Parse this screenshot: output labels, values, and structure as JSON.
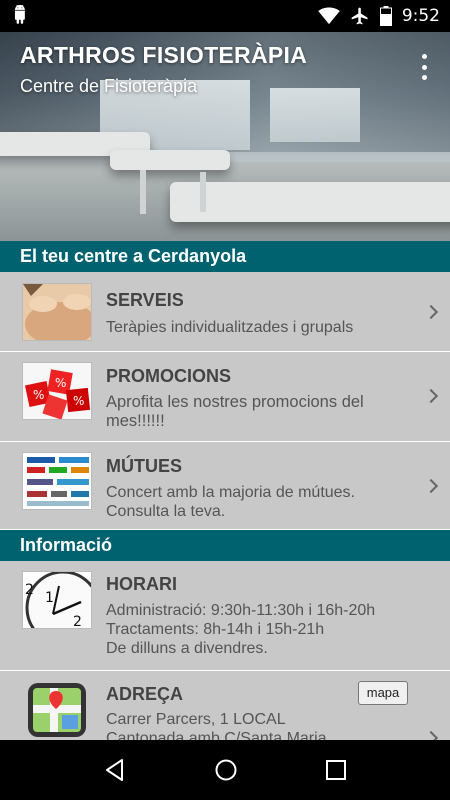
{
  "status_bar": {
    "time": "9:52",
    "battery_level": 0.6
  },
  "header": {
    "title": "ARTHROS FISIOTERÀPIA",
    "subtitle": "Centre de Fisioteràpia"
  },
  "sections": [
    {
      "title": "El teu centre a Cerdanyola",
      "items": [
        {
          "title": "SERVEIS",
          "description": "Teràpies individualitzades i grupals",
          "icon": "massage-photo-icon"
        },
        {
          "title": "PROMOCIONS",
          "description": "Aprofita les nostres promocions del mes!!!!!!",
          "icon": "percent-dice-icon"
        },
        {
          "title": "MÚTUES",
          "description": "Concert amb la majoria de mútues. Consulta la teva.",
          "icon": "insurance-logos-icon"
        }
      ]
    },
    {
      "title": "Informació",
      "items": [
        {
          "title": "HORARI",
          "lines": [
            "Administració: 9:30h-11:30h i 16h-20h",
            "Tractaments: 8h-14h i 15h-21h",
            "De dilluns a divendres."
          ],
          "icon": "clock-icon"
        },
        {
          "title": "ADREÇA",
          "lines": [
            "Carrer Parcers, 1 LOCAL",
            "Cantonada amb C/Santa Maria"
          ],
          "button_label": "mapa",
          "icon": "map-icon"
        }
      ]
    }
  ],
  "colors": {
    "section_header": "#00626e",
    "list_background": "#c8c8c8",
    "accent": "#00626e"
  }
}
